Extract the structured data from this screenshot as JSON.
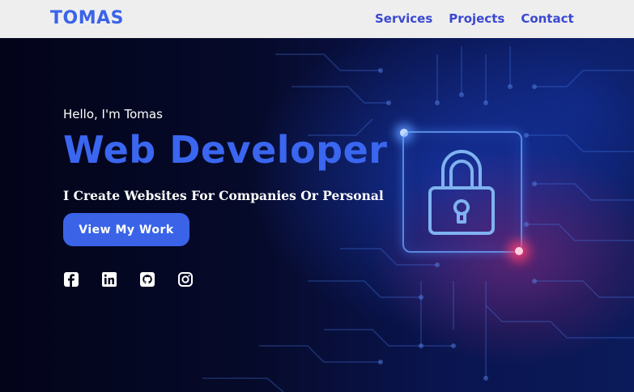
{
  "brand": {
    "logo_text": "TOMAS"
  },
  "nav": {
    "links": [
      {
        "label": "Services"
      },
      {
        "label": "Projects"
      },
      {
        "label": "Contact"
      }
    ]
  },
  "hero": {
    "greeting": "Hello, I'm Tomas",
    "headline": "Web Developer",
    "tagline": "I Create Websites For Companies Or Personal",
    "cta_label": "View My Work",
    "background_image": "circuit-board-lock"
  },
  "socials": [
    {
      "icon": "facebook-icon"
    },
    {
      "icon": "linkedin-icon"
    },
    {
      "icon": "github-icon"
    },
    {
      "icon": "instagram-icon"
    }
  ],
  "colors": {
    "accent": "#3a63e8",
    "nav_link": "#3a48d0",
    "navbar_bg": "#eeeeee",
    "hero_bg": "#05061a",
    "text_light": "#ffffff"
  }
}
